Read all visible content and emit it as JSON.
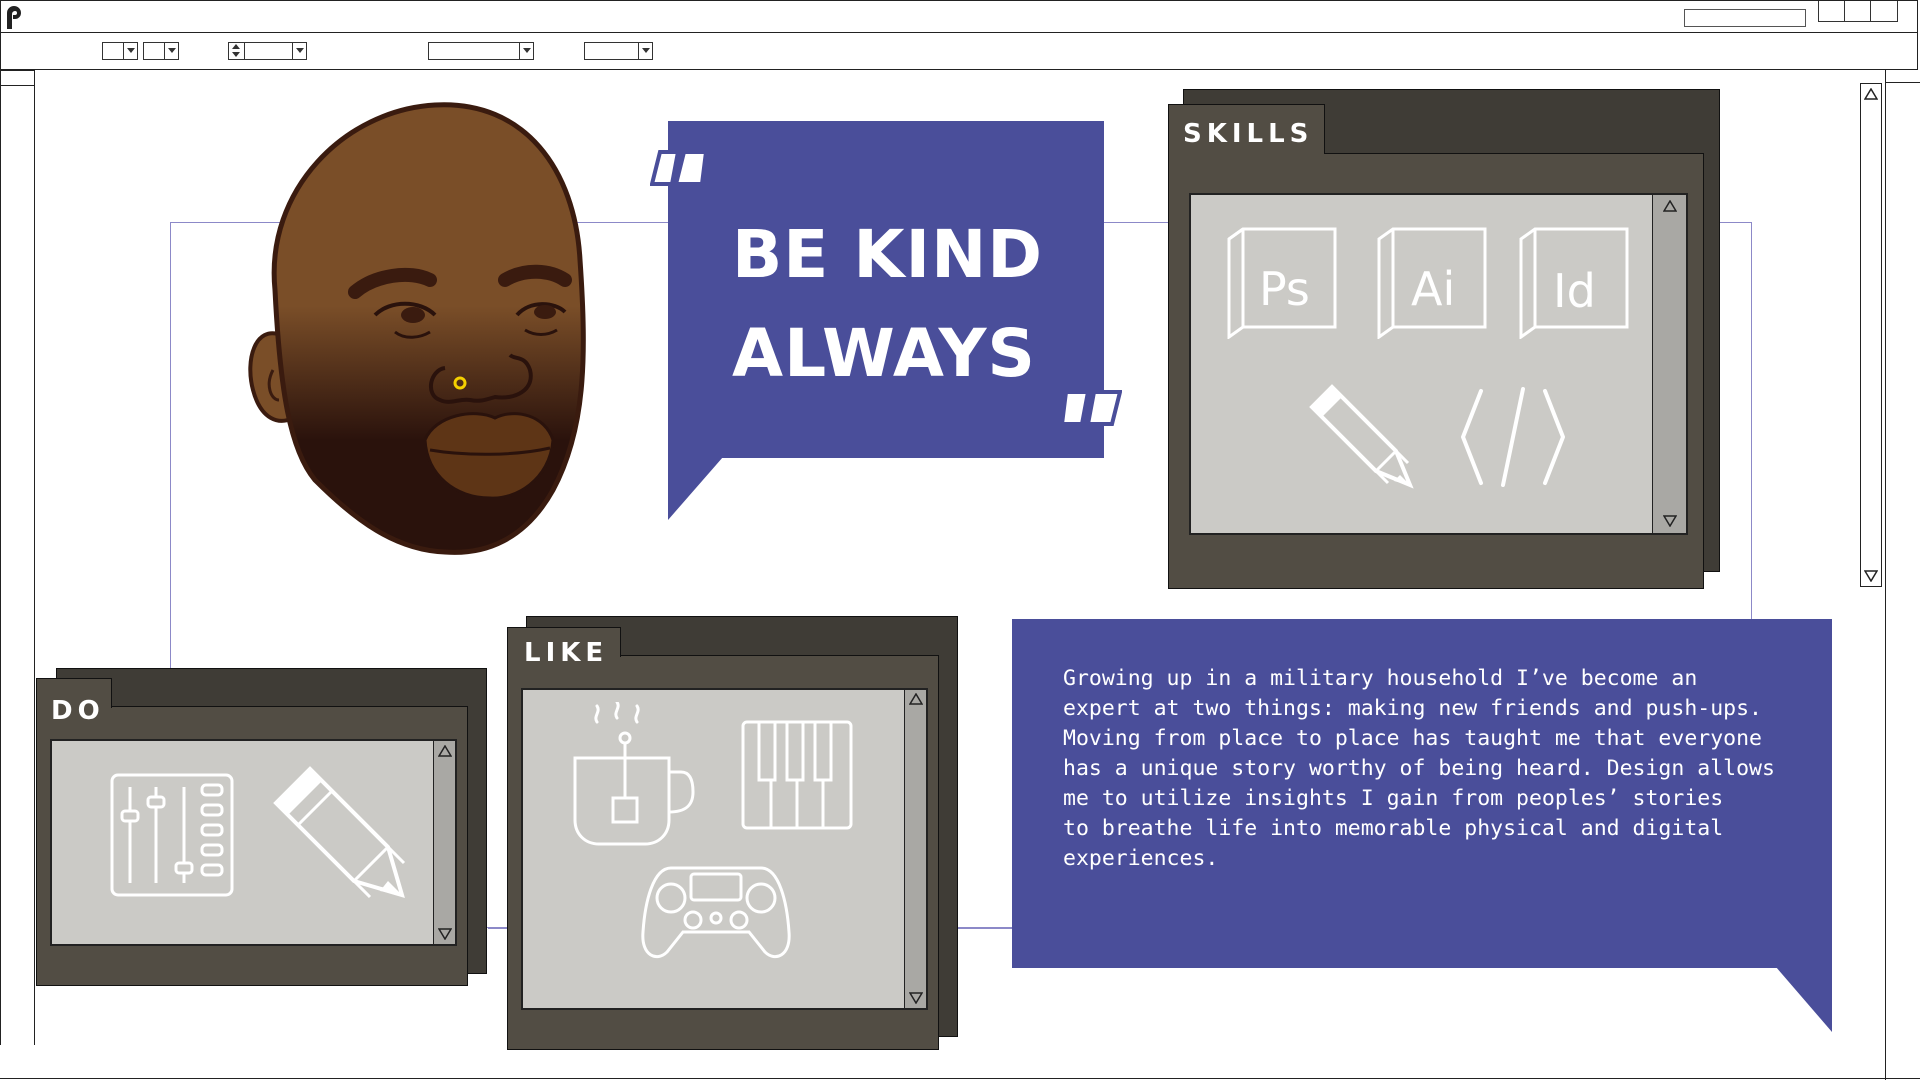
{
  "app": {
    "logo_icon": "brand-logo-icon"
  },
  "quote": {
    "line1": "BE KIND",
    "line2": "ALWAYS",
    "open_mark": "“",
    "close_mark": "”"
  },
  "windows": {
    "skills": {
      "title": "SKILLS",
      "icons": [
        "photoshop-icon",
        "illustrator-icon",
        "indesign-icon",
        "pencil-icon",
        "code-icon"
      ],
      "ps": "Ps",
      "ai": "Ai",
      "id": "Id"
    },
    "do": {
      "title": "DO",
      "icons": [
        "mixer-sliders-icon",
        "pencil-icon"
      ]
    },
    "like": {
      "title": "LIKE",
      "icons": [
        "tea-mug-icon",
        "piano-keys-icon",
        "gamepad-icon"
      ]
    }
  },
  "bio": {
    "text": "Growing up in a military household I’ve become an\nexpert at two things: making new friends and push-ups.\nMoving from place to place has taught me that everyone\nhas a unique story worthy of being heard. Design allows\nme to utilize insights I gain from peoples’ stories\nto breathe life into memorable physical and digital\nexperiences."
  },
  "colors": {
    "accent": "#4a4e9a",
    "window_dark": "#3f3c36",
    "window": "#524d44",
    "pane": "#cbcac6",
    "skin": "#7a4e28"
  }
}
